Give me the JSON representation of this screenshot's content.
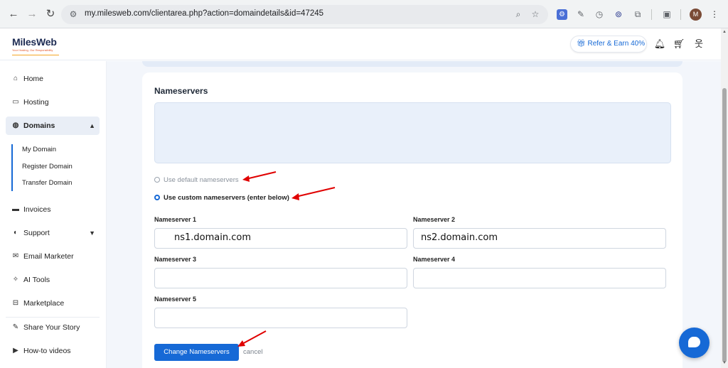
{
  "browser": {
    "url": "my.milesweb.com/clientarea.php?action=domaindetails&id=47245",
    "profile_initial": "M",
    "icons": [
      "back-icon",
      "forward-icon",
      "reload-icon",
      "site-settings-icon",
      "zoom-icon",
      "star-icon",
      "extension-icons",
      "profile-icon",
      "menu-icon"
    ]
  },
  "header": {
    "logo": "MilesWeb",
    "tagline": "Your Hosting, Our Responsibility",
    "refer_label": "Refer & Earn 40%"
  },
  "sidebar": {
    "items": [
      {
        "label": "Home",
        "icon": "home-icon"
      },
      {
        "label": "Hosting",
        "icon": "hosting-icon"
      },
      {
        "label": "Domains",
        "icon": "globe-icon"
      },
      {
        "label": "Invoices",
        "icon": "invoice-icon"
      },
      {
        "label": "Support",
        "icon": "support-icon"
      },
      {
        "label": "Email Marketer",
        "icon": "email-icon"
      },
      {
        "label": "AI Tools",
        "icon": "ai-icon"
      },
      {
        "label": "Marketplace",
        "icon": "marketplace-icon"
      },
      {
        "label": "Share Your Story",
        "icon": "edit-icon"
      },
      {
        "label": "How-to videos",
        "icon": "video-icon"
      }
    ],
    "domain_sub": [
      "My Domain",
      "Register Domain",
      "Transfer Domain"
    ]
  },
  "nameservers": {
    "title": "Nameservers",
    "option_default": "Use default nameservers",
    "option_custom": "Use custom nameservers (enter below)",
    "selected": "custom",
    "fields": [
      {
        "label": "Nameserver 1",
        "value": "ns1.domain.com"
      },
      {
        "label": "Nameserver 2",
        "value": "ns2.domain.com"
      },
      {
        "label": "Nameserver 3",
        "value": ""
      },
      {
        "label": "Nameserver 4",
        "value": ""
      },
      {
        "label": "Nameserver 5",
        "value": ""
      }
    ],
    "submit_label": "Change Nameservers",
    "cancel_label": "cancel"
  },
  "colors": {
    "accent": "#1669d6",
    "arrow": "#e00000",
    "logo_text": "#1d2b53"
  }
}
